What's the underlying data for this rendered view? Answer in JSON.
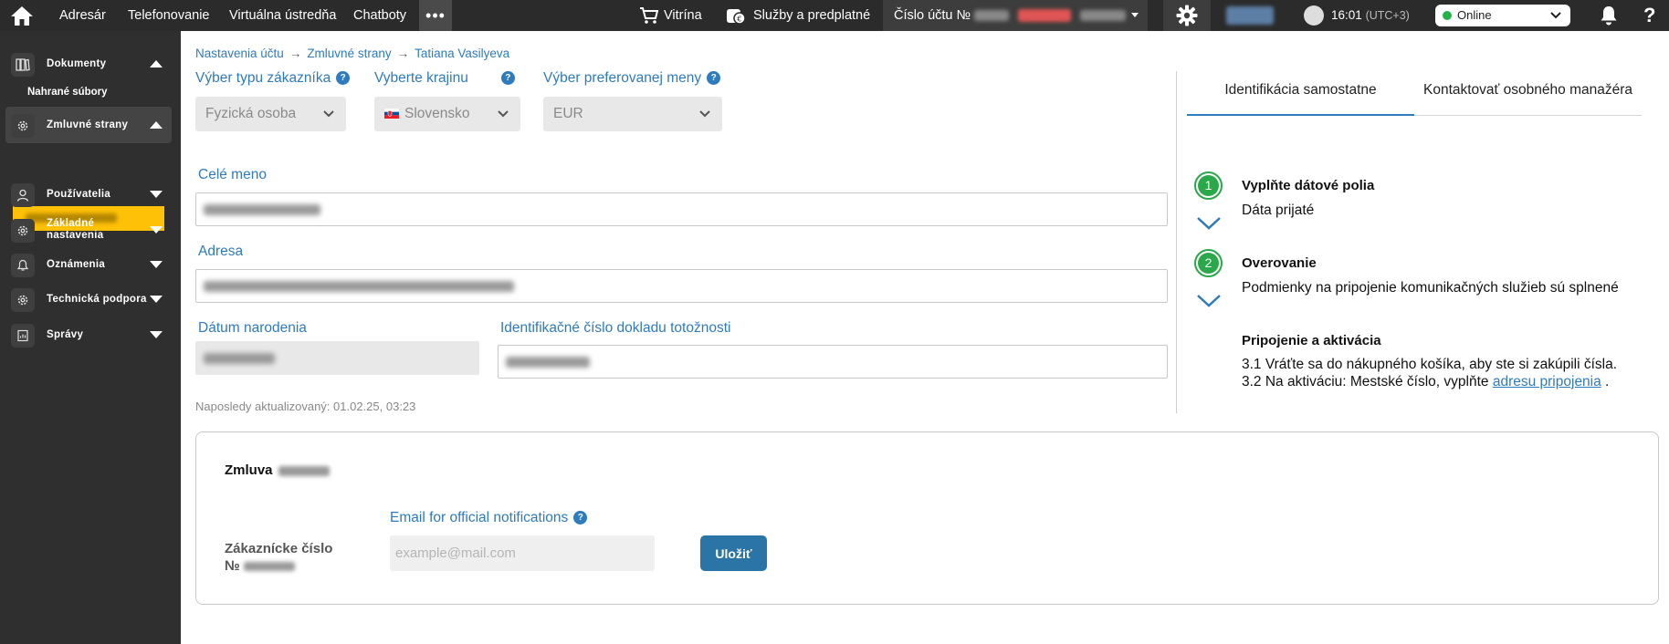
{
  "topbar": {
    "nav": [
      "Adresár",
      "Telefonovanie",
      "Virtuálna ústredňa",
      "Chatboty"
    ],
    "more": "•••",
    "showcase": "Vitrína",
    "services": "Služby a predplatné",
    "account_label": "Číslo účtu №",
    "time": "16:01",
    "timezone": "(UTC+3)",
    "status": "Online",
    "help": "?"
  },
  "sidebar": {
    "documents": "Dokumenty",
    "uploaded_files": "Nahrané súbory",
    "contract_parties": "Zmluvné strany",
    "users": "Používatelia",
    "basic_settings_1": "Základné",
    "basic_settings_2": "nastavenia",
    "notifications": "Oznámenia",
    "tech_support": "Technická podpora",
    "messages": "Správy"
  },
  "breadcrumb": [
    "Nastavenia účtu",
    "Zmluvné strany",
    "Tatiana Vasilyeva"
  ],
  "form": {
    "customer_type_label": "Výber typu zákazníka",
    "customer_type_value": "Fyzická osoba",
    "country_label": "Vyberte krajinu",
    "country_value": "Slovensko",
    "currency_label": "Výber preferovanej meny",
    "currency_value": "EUR",
    "full_name_label": "Celé meno",
    "address_label": "Adresa",
    "birth_date_label": "Dátum narodenia",
    "id_doc_label": "Identifikačné číslo dokladu totožnosti",
    "last_updated": "Naposledy aktualizovaný: 01.02.25, 03:23",
    "help_mark": "?"
  },
  "panel": {
    "tab_self": "Identifikácia samostatne",
    "tab_manager": "Kontaktovať osobného manažéra",
    "step1_num": "1",
    "step1_title": "Vyplňte dátové polia",
    "step1_text": "Dáta prijaté",
    "step2_num": "2",
    "step2_title": "Overovanie",
    "step2_text": "Podmienky na pripojenie komunikačných služieb sú splnené",
    "step3_title": "Pripojenie a aktivácia",
    "step3_line1": "3.1 Vráťte sa do nákupného košíka, aby ste si zakúpili čísla.",
    "step3_line2_prefix": "3.2 Na aktiváciu: Mestské číslo, vyplňte",
    "step3_link": "adresu pripojenia",
    "step3_line2_suffix": " ."
  },
  "contract": {
    "title": "Zmluva",
    "customer_no_1": "Zákaznícke číslo",
    "customer_no_2": "№",
    "email_label": "Email for official notifications",
    "email_placeholder": "example@mail.com",
    "save": "Uložiť"
  },
  "colors": {
    "accent": "#2e7bbd",
    "success": "#2aa84a",
    "highlight": "#ffc107",
    "topbar": "#2b2b2b",
    "sidebar": "#2f2f2f"
  }
}
